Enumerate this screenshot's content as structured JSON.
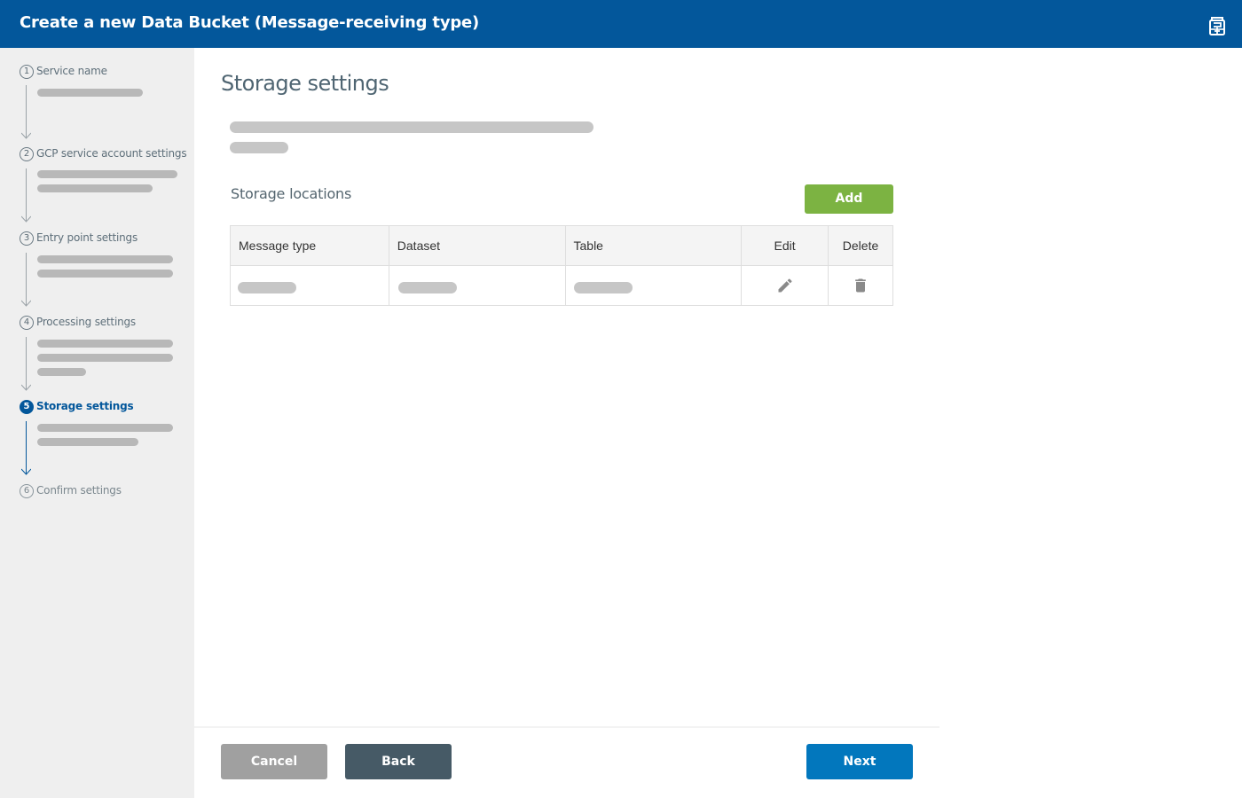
{
  "header": {
    "title": "Create a new Data Bucket (Message-receiving type)",
    "icon": "clipboard-save-icon",
    "background": "#03579b"
  },
  "sidebar": {
    "steps": [
      {
        "number": "1",
        "label": "Service name",
        "state": "completed"
      },
      {
        "number": "2",
        "label": "GCP service account settings",
        "state": "completed"
      },
      {
        "number": "3",
        "label": "Entry point settings",
        "state": "completed"
      },
      {
        "number": "4",
        "label": "Processing settings",
        "state": "completed"
      },
      {
        "number": "5",
        "label": "Storage settings",
        "state": "active"
      },
      {
        "number": "6",
        "label": "Confirm settings",
        "state": "upcoming"
      }
    ],
    "active_color": "#03579b"
  },
  "main": {
    "title": "Storage settings",
    "storage_locations": {
      "title": "Storage locations",
      "add_label": "Add",
      "columns": [
        "Message type",
        "Dataset",
        "Table",
        "Edit",
        "Delete"
      ],
      "rows": [
        {
          "message_type": "",
          "dataset": "",
          "table": "",
          "edit_icon": "pencil-icon",
          "delete_icon": "trash-icon"
        }
      ]
    }
  },
  "footer": {
    "cancel_label": "Cancel",
    "back_label": "Back",
    "next_label": "Next"
  },
  "colors": {
    "add": "#7cb342",
    "cancel": "#a0a0a0",
    "back": "#465a66",
    "next": "#0277bd"
  }
}
